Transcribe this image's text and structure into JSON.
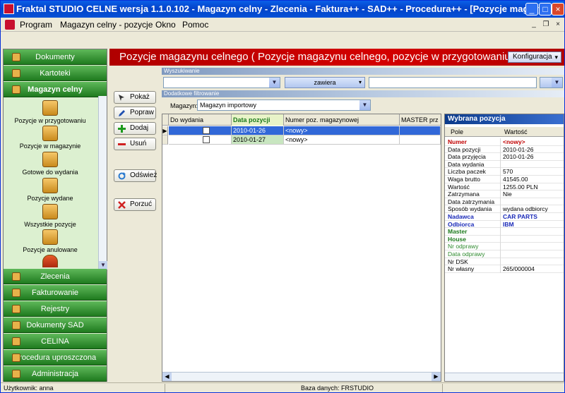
{
  "window": {
    "title": "Fraktal STUDIO CELNE  wersja 1.1.0.102 - Magazyn celny - Zlecenia - Faktura++ - SAD++ - Procedura++ - [Pozycje magazy...",
    "controls": [
      "_",
      "□",
      "×"
    ]
  },
  "menu": {
    "items": [
      "Program",
      "Magazyn celny - pozycje",
      "Okno",
      "Pomoc"
    ],
    "mdi_controls": [
      "_",
      "❐",
      "×"
    ]
  },
  "sidebar": {
    "groups_top": [
      {
        "label": "Dokumenty",
        "icon": "documents-icon"
      },
      {
        "label": "Kartoteki",
        "icon": "card-index-icon"
      },
      {
        "label": "Magazyn celny",
        "icon": "warehouse-icon"
      }
    ],
    "items": [
      {
        "label": "Pozycje w przygotowaniu",
        "icon": "locked-box-icon"
      },
      {
        "label": "Pozycje w magazynie",
        "icon": "warehouse-list-icon"
      },
      {
        "label": "Gotowe do wydania",
        "icon": "ready-icon"
      },
      {
        "label": "Pozycje wydane",
        "icon": "released-icon"
      },
      {
        "label": "Wszystkie pozycje",
        "icon": "all-items-icon"
      },
      {
        "label": "Pozycje anulowane",
        "icon": "cancelled-icon"
      }
    ],
    "groups_bottom": [
      {
        "label": "Zlecenia",
        "icon": "orders-icon"
      },
      {
        "label": "Fakturowanie",
        "icon": "invoicing-icon"
      },
      {
        "label": "Rejestry",
        "icon": "registers-icon"
      },
      {
        "label": "Dokumenty SAD",
        "icon": "sad-documents-icon"
      },
      {
        "label": "CELINA",
        "icon": "celina-icon"
      },
      {
        "label": "Procedura uproszczona",
        "icon": "simplified-procedure-icon"
      },
      {
        "label": "Administracja",
        "icon": "administration-icon"
      }
    ]
  },
  "banner": {
    "title": "Pozycje magazynu celnego ( Pozycje magazynu celnego, pozycje w przygotowaniu )",
    "config_label": "Konfiguracja"
  },
  "actions": {
    "show": "Pokaż",
    "edit": "Popraw",
    "add": "Dodaj",
    "delete": "Usuń",
    "refresh": "Odśwież",
    "abandon": "Porzuć"
  },
  "search": {
    "section_label": "Wyszukiwanie",
    "field_value": "",
    "mode_value": "zawiera",
    "text_value": ""
  },
  "filter": {
    "section_label": "Dodatkowe filtrowanie",
    "warehouse_label": "Magazyn:",
    "warehouse_value": "Magazyn importowy"
  },
  "grid": {
    "columns": [
      "Do wydania",
      "Data pozycji",
      "Numer poz. magazynowej",
      "MASTER prz"
    ],
    "rows": [
      {
        "date": "2010-01-26",
        "number": "<nowy>",
        "master": ""
      },
      {
        "date": "2010-01-27",
        "number": "<nowy>",
        "master": ""
      }
    ]
  },
  "details": {
    "title": "Wybrana pozycja",
    "col_field": "Pole",
    "col_value": "Wartość",
    "rows": [
      {
        "k": "Numer",
        "v": "<nowy>",
        "style": "red"
      },
      {
        "k": "Data pozycji",
        "v": "2010-01-26",
        "style": ""
      },
      {
        "k": "Data przyjęcia",
        "v": "2010-01-26",
        "style": ""
      },
      {
        "k": "Data wydania",
        "v": "",
        "style": ""
      },
      {
        "k": "Liczba paczek",
        "v": "570",
        "style": ""
      },
      {
        "k": "Waga brutto",
        "v": "41545.00",
        "style": ""
      },
      {
        "k": "Wartość",
        "v": "1255.00 PLN",
        "style": ""
      },
      {
        "k": "Zatrzymana",
        "v": "Nie",
        "style": ""
      },
      {
        "k": "Data zatrzymania",
        "v": "",
        "style": ""
      },
      {
        "k": "Sposób wydania",
        "v": "wydana odbiorcy",
        "style": ""
      },
      {
        "k": "Nadawca",
        "v": "CAR PARTS",
        "style": "blue"
      },
      {
        "k": "Odbiorca",
        "v": "IBM",
        "style": "blue"
      },
      {
        "k": "Master",
        "v": "",
        "style": "green"
      },
      {
        "k": "House",
        "v": "",
        "style": "green"
      },
      {
        "k": "Nr odprawy",
        "v": "",
        "style": "lgreen"
      },
      {
        "k": "Data odprawy",
        "v": "",
        "style": "lgreen"
      },
      {
        "k": "Nr DSK",
        "v": "",
        "style": ""
      },
      {
        "k": "Nr własny",
        "v": "265/000004",
        "style": ""
      }
    ]
  },
  "status": {
    "user": "Użytkownik: anna",
    "database": "Baza danych: FRSTUDIO"
  },
  "colors": {
    "banner": "#c80000",
    "sidebar_group": "#1e7a1e",
    "selection": "#3168d8"
  }
}
